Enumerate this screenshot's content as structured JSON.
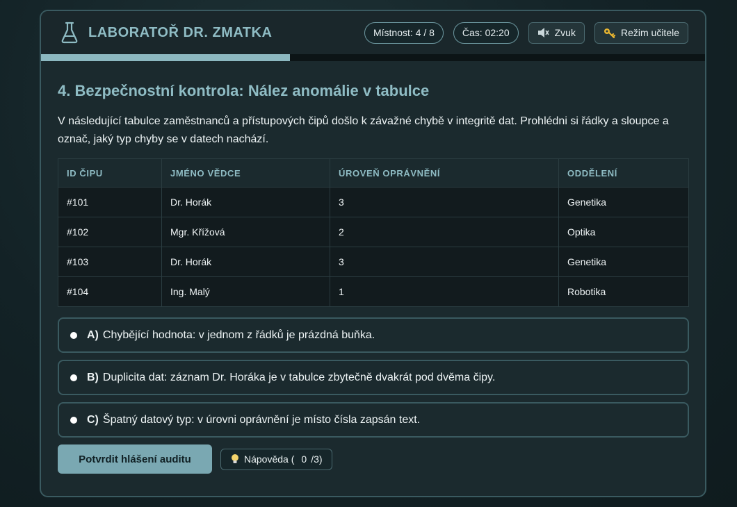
{
  "app": {
    "title": "LABORATOŘ DR. ZMATKA",
    "room": "Místnost: 4 / 8",
    "time": "Čas: 02:20",
    "sound_label": "Zvuk",
    "teacher_label": "Režim učitele",
    "progress_fraction": 0.375,
    "icons": {
      "logo": "flask-icon",
      "sound": "speaker-muted-icon",
      "teacher": "key-icon",
      "hint": "lightbulb-icon"
    }
  },
  "task": {
    "title": "4. Bezpečnostní kontrola: Nález anomálie v tabulce",
    "description": "V následující tabulce zaměstnanců a přístupových čipů došlo k závažné chybě v integritě dat. Prohlédni si řádky a sloupce a označ, jaký typ chyby se v datech nachází."
  },
  "table": {
    "headers": [
      "ID ČIPU",
      "JMÉNO VĚDCE",
      "ÚROVEŇ OPRÁVNĚNÍ",
      "ODDĚLENÍ"
    ],
    "rows": [
      [
        "#101",
        "Dr. Horák",
        "3",
        "Genetika"
      ],
      [
        "#102",
        "Mgr. Křížová",
        "2",
        "Optika"
      ],
      [
        "#103",
        "Dr. Horák",
        "3",
        "Genetika"
      ],
      [
        "#104",
        "Ing. Malý",
        "1",
        "Robotika"
      ]
    ]
  },
  "options": [
    {
      "letter": "A)",
      "text": "Chybějící hodnota: v jednom z řádků je prázdná buňka."
    },
    {
      "letter": "B)",
      "text": "Duplicita dat: záznam Dr. Horáka je v tabulce zbytečně dvakrát pod dvěma čipy."
    },
    {
      "letter": "C)",
      "text": "Špatný datový typ: v úrovni oprávnění je místo čísla zapsán text."
    }
  ],
  "actions": {
    "submit_label": "Potvrdit hlášení auditu",
    "hint_label": "Nápověda (",
    "hint_used": "0",
    "hint_total": "/3)"
  },
  "colors": {
    "accent": "#8fbcc4",
    "border": "#3a5a60",
    "submit_bg": "#7aa8b2"
  }
}
